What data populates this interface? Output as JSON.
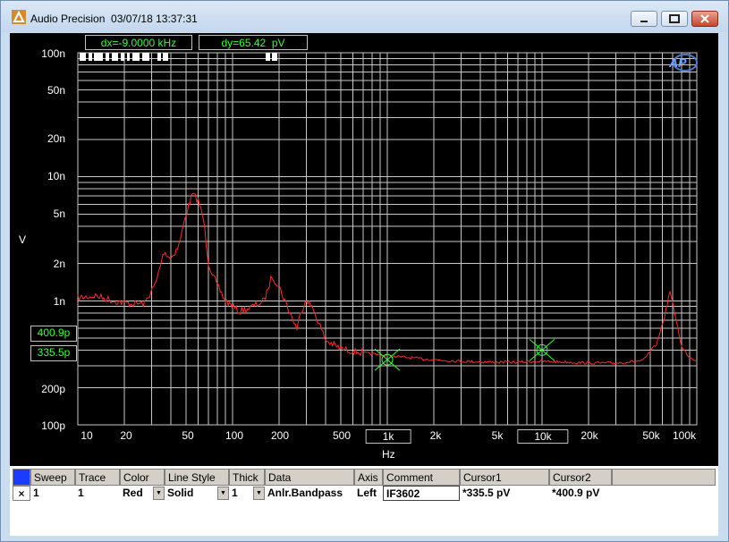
{
  "window": {
    "title": "Audio Precision  03/07/18 13:37:31"
  },
  "readouts": {
    "dx": "dx=-9.0000 kHz",
    "dy": "dy=65.42  pV"
  },
  "graph": {
    "y_unit": "V",
    "x_unit": "Hz",
    "y_ticks": [
      "100n",
      "50n",
      "20n",
      "10n",
      "5n",
      "2n",
      "1n",
      "200p",
      "100p"
    ],
    "x_ticks": [
      "10",
      "20",
      "50",
      "100",
      "200",
      "500",
      "1k",
      "2k",
      "5k",
      "10k",
      "20k",
      "50k",
      "100k"
    ],
    "cursor1_value": "335.5p",
    "cursor2_value": "400.9p",
    "trace_color": "#ff2a2a",
    "cursor_color": "#33ff33"
  },
  "table": {
    "headers": [
      "Sweep",
      "Trace",
      "Color",
      "Line Style",
      "Thick",
      "Data",
      "Axis",
      "Comment",
      "Cursor1",
      "Cursor2"
    ],
    "rows": [
      {
        "enabled": "×",
        "sweep": "1",
        "trace": "1",
        "color": "Red",
        "line_style": "Solid",
        "thick": "1",
        "data": "Anlr.Bandpass",
        "axis": "Left",
        "comment": "IF3602",
        "cursor1": "*335.5  pV",
        "cursor2": "*400.9  pV"
      }
    ]
  },
  "chart_data": {
    "type": "line",
    "x_scale": "log",
    "y_scale": "log",
    "xlim": [
      10,
      100000
    ],
    "ylim": [
      1e-10,
      1e-07
    ],
    "xlabel": "Hz",
    "ylabel": "V",
    "series": [
      {
        "x": [
          10,
          13,
          17,
          22,
          27,
          32,
          36,
          40,
          45,
          50,
          55,
          60,
          65,
          70,
          80,
          90,
          110,
          130,
          160,
          180,
          200,
          230,
          260,
          280,
          300,
          340,
          400,
          500,
          700,
          1000,
          1500,
          2000,
          3000,
          5000,
          7000,
          10000,
          15000,
          20000,
          30000,
          45000,
          55000,
          62000,
          67000,
          72000,
          80000,
          90000,
          100000
        ],
        "y": [
          1.05e-09,
          1.1e-09,
          1e-09,
          9.5e-10,
          9.5e-10,
          1.4e-09,
          2.5e-09,
          2.2e-09,
          2.8e-09,
          5e-09,
          7.2e-09,
          6.5e-09,
          4.5e-09,
          2e-09,
          1.3e-09,
          1e-09,
          8.2e-10,
          8.8e-10,
          1e-09,
          1.6e-09,
          1.3e-09,
          8.5e-10,
          6e-10,
          8.5e-10,
          1.05e-09,
          8e-10,
          4.8e-10,
          4.1e-10,
          3.8e-10,
          3.6e-10,
          3.45e-10,
          3.35e-10,
          3.25e-10,
          3.2e-10,
          3.2e-10,
          3.25e-10,
          3.2e-10,
          3.15e-10,
          3.15e-10,
          3.3e-10,
          4.5e-10,
          7.5e-10,
          1.2e-09,
          8e-10,
          4.2e-10,
          3.5e-10,
          3.3e-10
        ]
      }
    ],
    "cursors": [
      {
        "x": 1000,
        "y": 3.355e-10
      },
      {
        "x": 10000,
        "y": 4.009e-10
      }
    ],
    "grid": true
  }
}
